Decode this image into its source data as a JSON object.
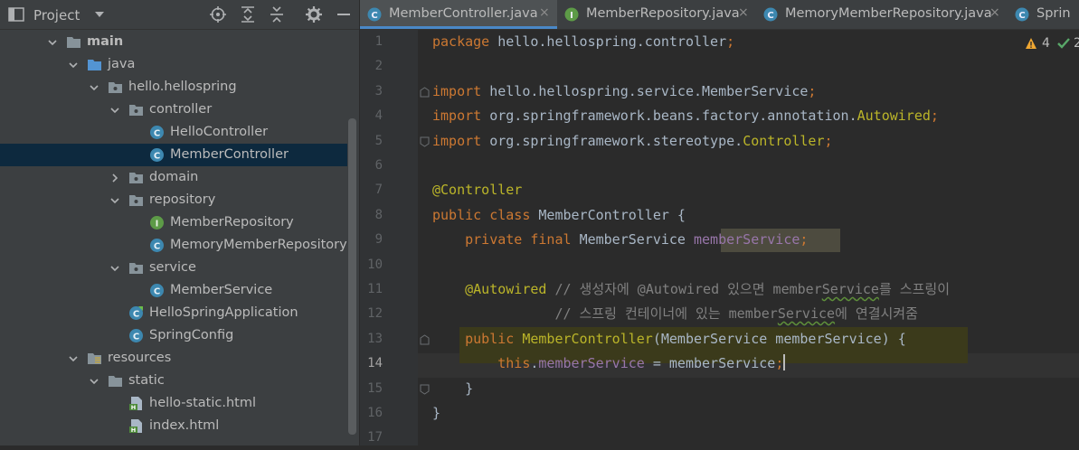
{
  "project_panel": {
    "title": "Project",
    "tree": [
      {
        "label": "main",
        "kind": "folder",
        "depth": 2,
        "expanded": true,
        "bold": true
      },
      {
        "label": "java",
        "kind": "folder-src",
        "depth": 3,
        "expanded": true
      },
      {
        "label": "hello.hellospring",
        "kind": "package",
        "depth": 4,
        "expanded": true
      },
      {
        "label": "controller",
        "kind": "package",
        "depth": 5,
        "expanded": true
      },
      {
        "label": "HelloController",
        "kind": "class",
        "depth": 6
      },
      {
        "label": "MemberController",
        "kind": "class",
        "depth": 6,
        "selected": true
      },
      {
        "label": "domain",
        "kind": "package",
        "depth": 5,
        "expanded": false
      },
      {
        "label": "repository",
        "kind": "package",
        "depth": 5,
        "expanded": true
      },
      {
        "label": "MemberRepository",
        "kind": "interface",
        "depth": 6
      },
      {
        "label": "MemoryMemberRepository",
        "kind": "class",
        "depth": 6
      },
      {
        "label": "service",
        "kind": "package",
        "depth": 5,
        "expanded": true
      },
      {
        "label": "MemberService",
        "kind": "class",
        "depth": 6
      },
      {
        "label": "HelloSpringApplication",
        "kind": "spring-class",
        "depth": 5
      },
      {
        "label": "SpringConfig",
        "kind": "class",
        "depth": 5
      },
      {
        "label": "resources",
        "kind": "folder-res",
        "depth": 3,
        "expanded": true
      },
      {
        "label": "static",
        "kind": "folder",
        "depth": 4,
        "expanded": true
      },
      {
        "label": "hello-static.html",
        "kind": "html",
        "depth": 5
      },
      {
        "label": "index.html",
        "kind": "html",
        "depth": 5
      }
    ]
  },
  "tabs": [
    {
      "label": "MemberController.java",
      "kind": "class",
      "active": true,
      "close": "×"
    },
    {
      "label": "MemberRepository.java",
      "kind": "interface",
      "active": false,
      "close": "×"
    },
    {
      "label": "MemoryMemberRepository.java",
      "kind": "class",
      "active": false,
      "close": "×"
    },
    {
      "label": "Sprin",
      "kind": "class",
      "active": false,
      "close": ""
    }
  ],
  "inspection": {
    "warnings": "4",
    "ok_count": "2"
  },
  "colors": {
    "accent": "#4a88c7",
    "keyword": "#cc7832",
    "annotation": "#bbb529",
    "field": "#9876aa",
    "comment": "#808080"
  },
  "editor": {
    "current_line": 14,
    "lines": [
      {
        "n": "1",
        "t": [
          [
            "kw",
            "package "
          ],
          [
            "",
            "hello.hellospring.controller"
          ],
          [
            "kw",
            ";"
          ]
        ]
      },
      {
        "n": "2",
        "t": []
      },
      {
        "n": "3",
        "t": [
          [
            "kw",
            "import "
          ],
          [
            "",
            "hello.hellospring.service.MemberService"
          ],
          [
            "kw",
            ";"
          ]
        ]
      },
      {
        "n": "4",
        "t": [
          [
            "kw",
            "import "
          ],
          [
            "",
            "org.springframework.beans.factory.annotation."
          ],
          [
            "ann",
            "Autowired"
          ],
          [
            "kw",
            ";"
          ]
        ]
      },
      {
        "n": "5",
        "t": [
          [
            "kw",
            "import "
          ],
          [
            "",
            "org.springframework.stereotype."
          ],
          [
            "ann",
            "Controller"
          ],
          [
            "kw",
            ";"
          ]
        ]
      },
      {
        "n": "6",
        "t": []
      },
      {
        "n": "7",
        "t": [
          [
            "ann",
            "@Controller"
          ]
        ]
      },
      {
        "n": "8",
        "t": [
          [
            "kw",
            "public class "
          ],
          [
            "",
            "MemberController {"
          ]
        ]
      },
      {
        "n": "9",
        "t": [
          [
            "",
            "    "
          ],
          [
            "kw",
            "private final "
          ],
          [
            "",
            "MemberService "
          ],
          [
            "fld",
            "memberService"
          ],
          [
            "kw",
            ";"
          ]
        ]
      },
      {
        "n": "10",
        "t": []
      },
      {
        "n": "11",
        "t": [
          [
            "",
            "    "
          ],
          [
            "ann",
            "@Autowired "
          ],
          [
            "cmt",
            "// 생성자에 @Autowired 있으면 member"
          ],
          [
            "cmt sq",
            "Service"
          ],
          [
            "cmt",
            "를 스프링이"
          ]
        ]
      },
      {
        "n": "12",
        "t": [
          [
            "",
            "               "
          ],
          [
            "cmt",
            "// 스프링 컨테이너에 있는 member"
          ],
          [
            "cmt sq",
            "Service"
          ],
          [
            "cmt",
            "에 연결시켜줌"
          ]
        ]
      },
      {
        "n": "13",
        "t": [
          [
            "",
            "    "
          ],
          [
            "kw",
            "public "
          ],
          [
            "ann",
            "MemberController"
          ],
          [
            "",
            "(MemberService memberService) {"
          ]
        ]
      },
      {
        "n": "14",
        "t": [
          [
            "",
            "        "
          ],
          [
            "kw",
            "this"
          ],
          [
            "",
            "."
          ],
          [
            "fld",
            "memberService"
          ],
          [
            "",
            " = memberService"
          ],
          [
            "kw",
            ";"
          ]
        ]
      },
      {
        "n": "15",
        "t": [
          [
            "",
            "    }"
          ]
        ]
      },
      {
        "n": "16",
        "t": [
          [
            "",
            "}"
          ]
        ]
      },
      {
        "n": "17",
        "t": []
      }
    ]
  }
}
